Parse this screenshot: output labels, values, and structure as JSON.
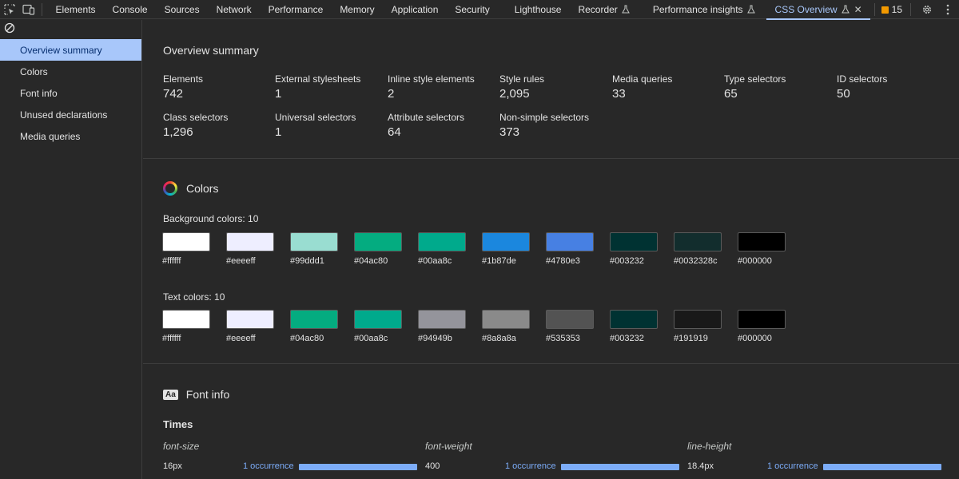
{
  "toolbar": {
    "tabs": [
      {
        "label": "Elements"
      },
      {
        "label": "Console"
      },
      {
        "label": "Sources"
      },
      {
        "label": "Network"
      },
      {
        "label": "Performance"
      },
      {
        "label": "Memory"
      },
      {
        "label": "Application"
      },
      {
        "label": "Security"
      },
      {
        "label": "Lighthouse"
      },
      {
        "label": "Recorder"
      },
      {
        "label": "Performance insights"
      },
      {
        "label": "CSS Overview"
      }
    ],
    "issues_count": "15",
    "accent": "#a8c7fa",
    "icons": [
      "inspect-element-icon",
      "device-toolbar-icon",
      "flask-icon",
      "close-icon",
      "issues-flag-icon",
      "gear-icon",
      "kebab-menu-icon"
    ]
  },
  "sidebar": {
    "items": [
      {
        "label": "Overview summary"
      },
      {
        "label": "Colors"
      },
      {
        "label": "Font info"
      },
      {
        "label": "Unused declarations"
      },
      {
        "label": "Media queries"
      }
    ],
    "active_color": "#a8c7fa"
  },
  "overview": {
    "title": "Overview summary",
    "stats": [
      {
        "label": "Elements",
        "value": "742"
      },
      {
        "label": "External stylesheets",
        "value": "1"
      },
      {
        "label": "Inline style elements",
        "value": "2"
      },
      {
        "label": "Style rules",
        "value": "2,095"
      },
      {
        "label": "Media queries",
        "value": "33"
      },
      {
        "label": "Type selectors",
        "value": "65"
      },
      {
        "label": "ID selectors",
        "value": "50"
      },
      {
        "label": "Class selectors",
        "value": "1,296"
      },
      {
        "label": "Universal selectors",
        "value": "1"
      },
      {
        "label": "Attribute selectors",
        "value": "64"
      },
      {
        "label": "Non-simple selectors",
        "value": "373"
      }
    ]
  },
  "colors": {
    "title": "Colors",
    "background_label": "Background colors: 10",
    "background": [
      "#ffffff",
      "#eeeeff",
      "#99ddd1",
      "#04ac80",
      "#00aa8c",
      "#1b87de",
      "#4780e3",
      "#003232",
      "#0032328c",
      "#000000"
    ],
    "text_label": "Text colors: 10",
    "text": [
      "#ffffff",
      "#eeeeff",
      "#04ac80",
      "#00aa8c",
      "#94949b",
      "#8a8a8a",
      "#535353",
      "#003232",
      "#191919",
      "#000000"
    ]
  },
  "font_info": {
    "title": "Font info",
    "badge": "Aa",
    "family": "Times",
    "columns": [
      {
        "prop": "font-size",
        "value": "16px",
        "occurrence": "1 occurrence"
      },
      {
        "prop": "font-weight",
        "value": "400",
        "occurrence": "1 occurrence"
      },
      {
        "prop": "line-height",
        "value": "18.4px",
        "occurrence": "1 occurrence"
      }
    ],
    "bar_color": "#7cacf8"
  }
}
